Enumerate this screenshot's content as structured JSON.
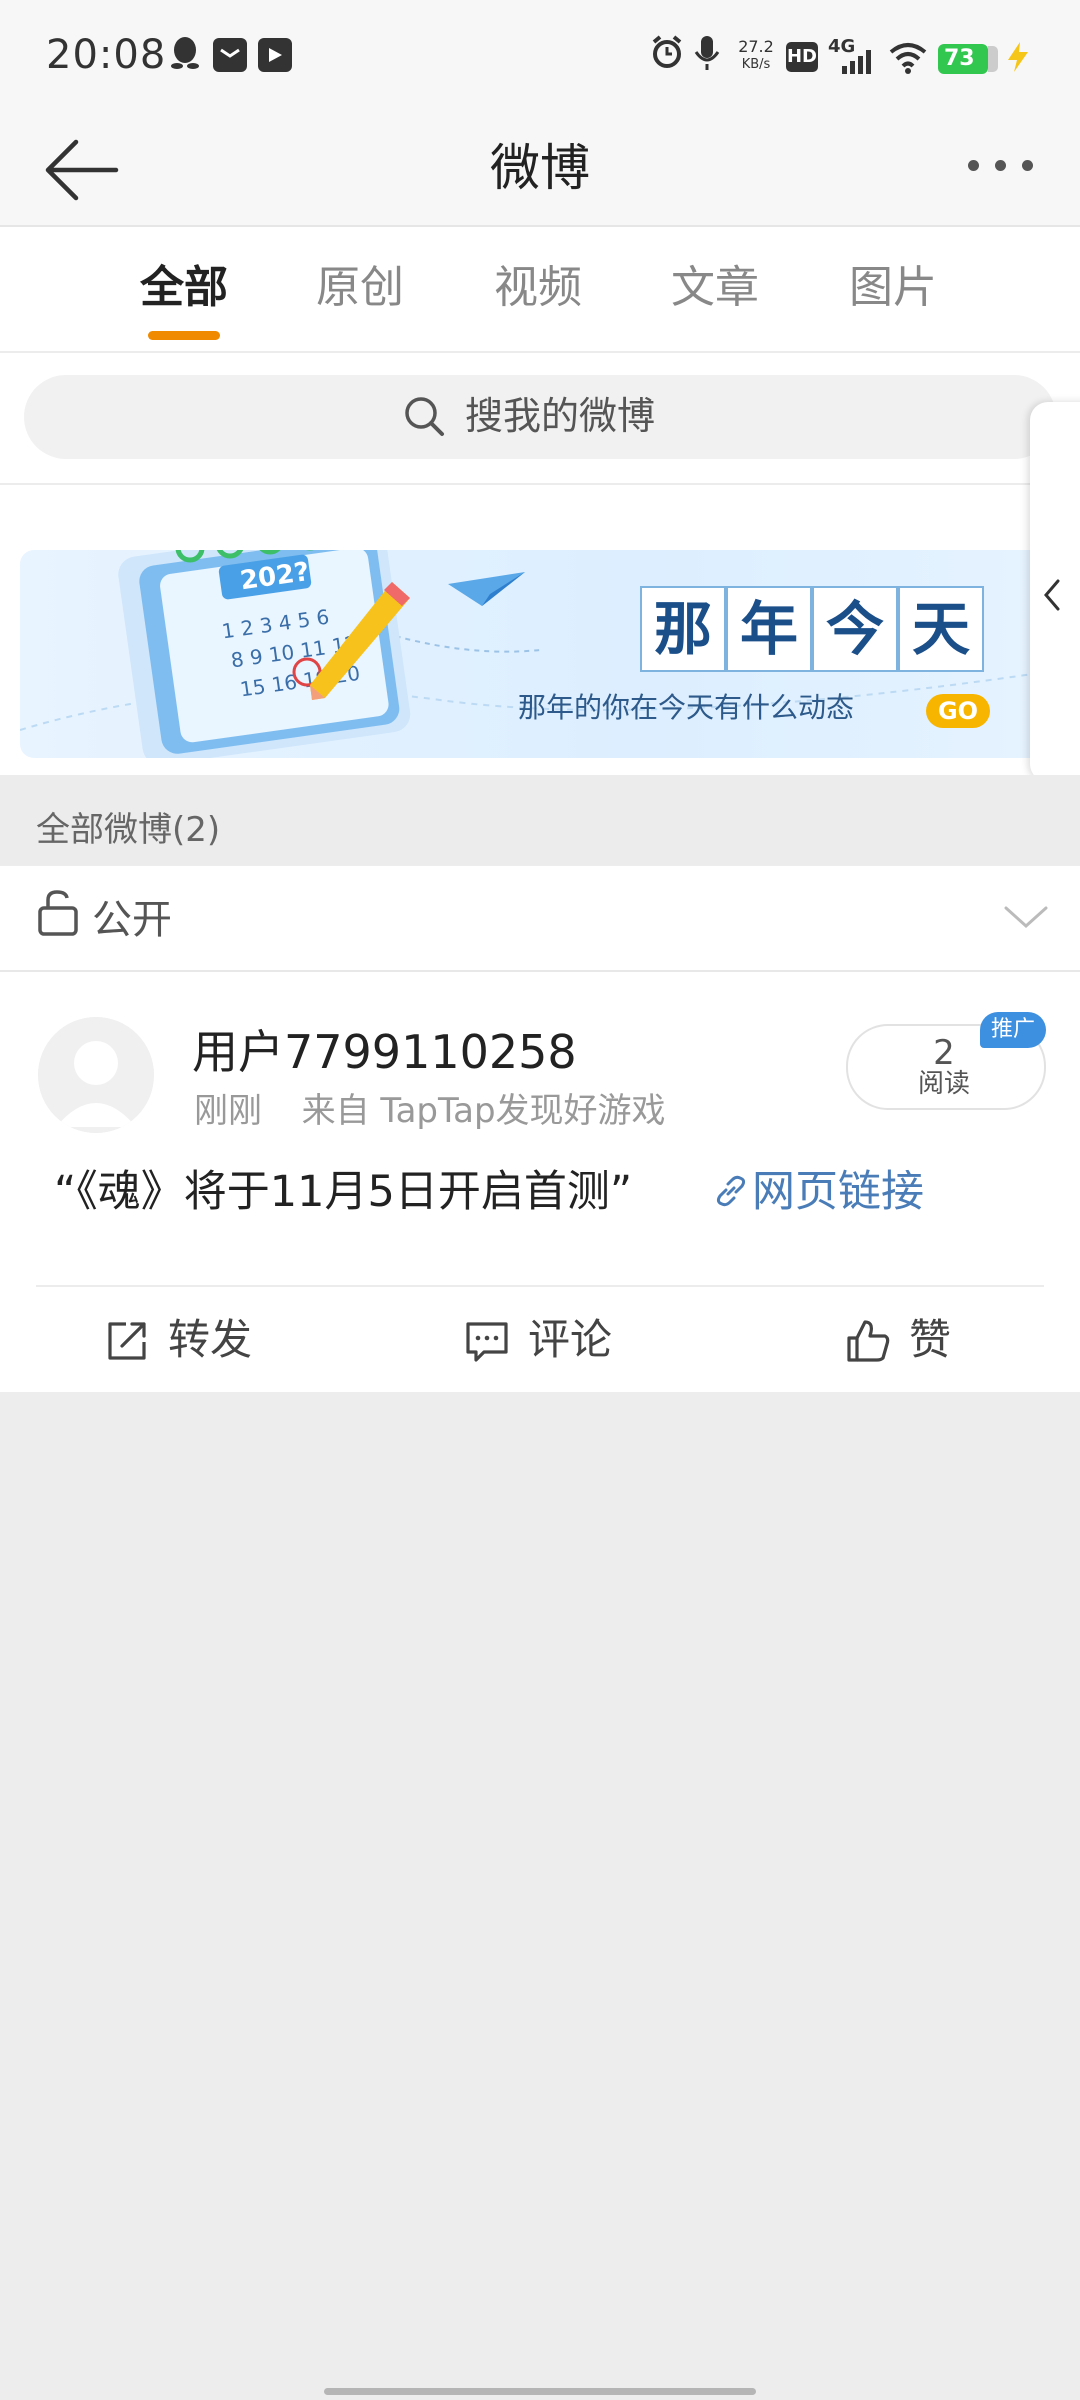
{
  "status_bar": {
    "time": "20:08",
    "net_speed_value": "27.2",
    "net_speed_unit": "KB/s",
    "hd": "HD",
    "network": "4G",
    "battery": "73",
    "icons": [
      "qq-icon",
      "message-icon",
      "app-notification-icon",
      "alarm-icon",
      "mic-icon",
      "signal-icon",
      "wifi-icon",
      "battery-icon",
      "charging-icon"
    ]
  },
  "nav": {
    "title": "微博"
  },
  "tabs": [
    {
      "label": "全部",
      "active": true
    },
    {
      "label": "原创",
      "active": false
    },
    {
      "label": "视频",
      "active": false
    },
    {
      "label": "文章",
      "active": false
    },
    {
      "label": "图片",
      "active": false
    }
  ],
  "search": {
    "placeholder": "搜我的微博"
  },
  "banner": {
    "title_chars": [
      "那",
      "年",
      "今",
      "天"
    ],
    "subtitle": "那年的你在今天有什么动态",
    "go": "GO",
    "calendar_year": "202?"
  },
  "section": {
    "title": "全部微博(2)"
  },
  "visibility": {
    "label": "公开"
  },
  "post": {
    "username": "用户7799110258",
    "time": "刚刚",
    "source": "来自 TapTap发现好游戏",
    "read_count": "2",
    "read_label": "阅读",
    "promo_badge": "推广",
    "text": "“《魂》将于11月5日开启首测”",
    "link_text": "网页链接",
    "actions": {
      "repost": "转发",
      "comment": "评论",
      "like": "赞"
    }
  },
  "colors": {
    "accent": "#f08a00",
    "link": "#4a7db8",
    "battery": "#32c850",
    "promo": "#3d8fe0"
  }
}
